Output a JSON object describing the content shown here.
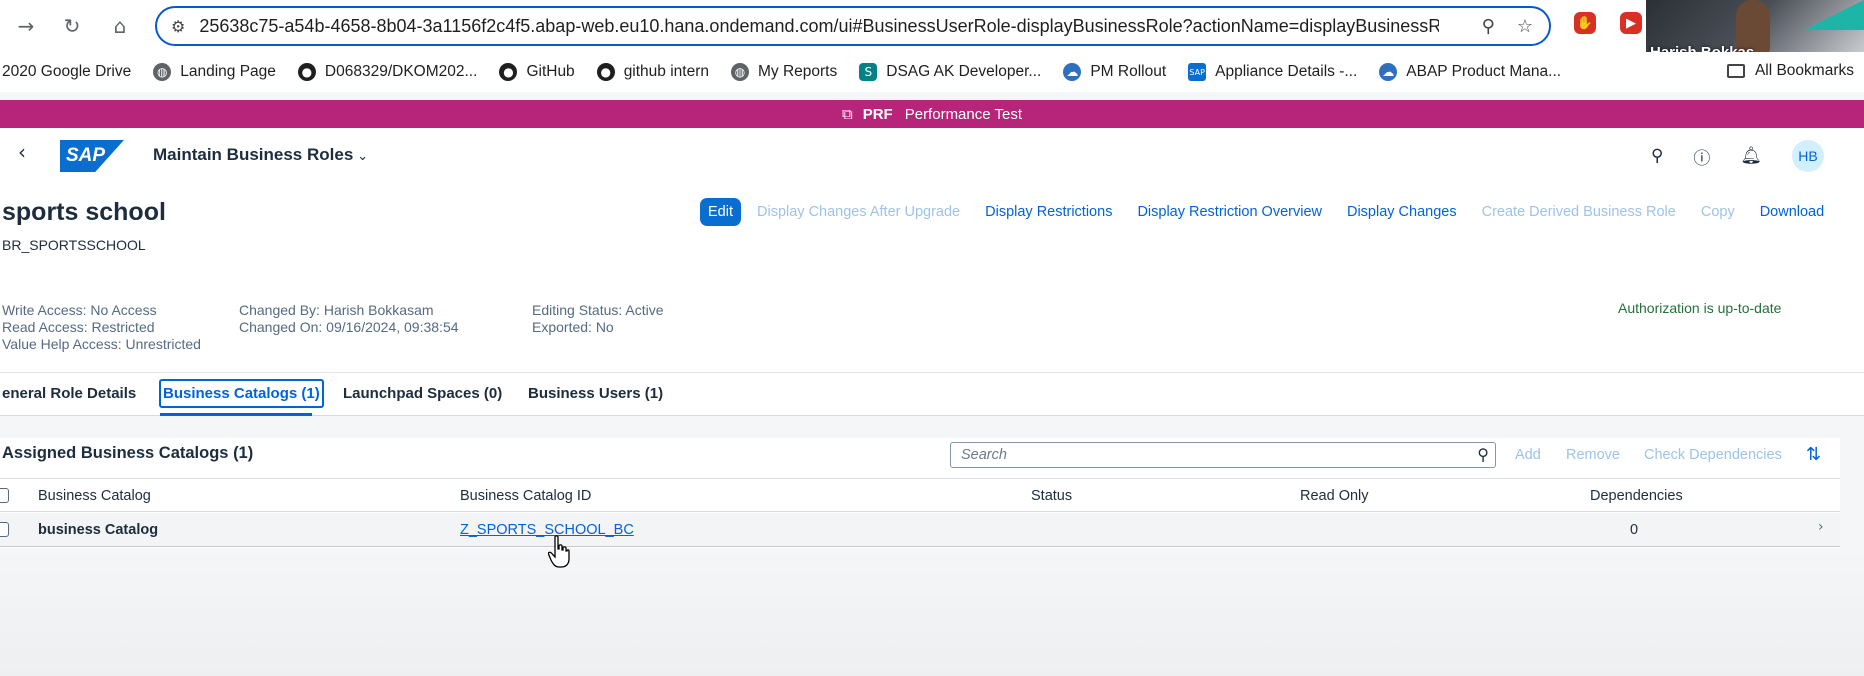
{
  "browser": {
    "url": "25638c75-a54b-4658-8b04-3a1156f2c4f5.abap-web.eu10.hana.ondemand.com/ui#BusinessUserRole-displayBusinessRole?actionName=displayBusinessR...",
    "bookmarks": [
      {
        "label": "2020 Google Drive",
        "icon": "google-drive-icon"
      },
      {
        "label": "Landing Page",
        "icon": "globe-icon",
        "color": "#5f6368"
      },
      {
        "label": "D068329/DKOM202...",
        "icon": "github-icon",
        "color": "#1f1f1f"
      },
      {
        "label": "GitHub",
        "icon": "github-icon",
        "color": "#1f1f1f"
      },
      {
        "label": "github intern",
        "icon": "github-icon",
        "color": "#1f1f1f"
      },
      {
        "label": "My Reports",
        "icon": "globe-icon",
        "color": "#5f6368"
      },
      {
        "label": "DSAG AK Developer...",
        "icon": "sharepoint-icon",
        "color": "#038387"
      },
      {
        "label": "PM Rollout",
        "icon": "cloud-icon",
        "color": "#2f6fbf"
      },
      {
        "label": "Appliance Details -...",
        "icon": "sap-icon",
        "color": "#0a6ed1"
      },
      {
        "label": "ABAP Product Mana...",
        "icon": "cloud-icon",
        "color": "#2f6fbf"
      }
    ],
    "all_bookmarks": "All Bookmarks",
    "video_name": "Harish Bokkas..."
  },
  "system_banner": {
    "id": "PRF",
    "name": "Performance Test",
    "color": "#b7257b"
  },
  "shell": {
    "app_title": "Maintain Business Roles",
    "avatar": "HB"
  },
  "header": {
    "title": "sports school",
    "subtitle": "BR_SPORTSSCHOOL",
    "actions": [
      {
        "label": "Edit",
        "state": "primary"
      },
      {
        "label": "Display Changes After Upgrade",
        "state": "disabled"
      },
      {
        "label": "Display Restrictions",
        "state": "enabled"
      },
      {
        "label": "Display Restriction Overview",
        "state": "enabled"
      },
      {
        "label": "Display Changes",
        "state": "enabled"
      },
      {
        "label": "Create Derived Business Role",
        "state": "disabled"
      },
      {
        "label": "Copy",
        "state": "disabled"
      },
      {
        "label": "Download",
        "state": "enabled"
      }
    ],
    "write_access": "Write Access: No Access",
    "read_access": "Read Access: Restricted",
    "value_help_access": "Value Help Access: Unrestricted",
    "changed_by": "Changed By: Harish Bokkasam",
    "changed_on": "Changed On: 09/16/2024, 09:38:54",
    "editing_status": "Editing Status: Active",
    "exported": "Exported: No",
    "auth_status": "Authorization is up-to-date"
  },
  "tabs": [
    {
      "label": "eneral Role Details",
      "active": false
    },
    {
      "label": "Business Catalogs (1)",
      "active": true
    },
    {
      "label": "Launchpad Spaces (0)",
      "active": false
    },
    {
      "label": "Business Users (1)",
      "active": false
    }
  ],
  "catalogs": {
    "title": "Assigned Business Catalogs (1)",
    "search_placeholder": "Search",
    "toolbar": [
      "Add",
      "Remove",
      "Check Dependencies"
    ],
    "columns": [
      "Business Catalog",
      "Business Catalog ID",
      "Status",
      "Read Only",
      "Dependencies"
    ],
    "rows": [
      {
        "name": "business Catalog",
        "id": "Z_SPORTS_SCHOOL_BC",
        "status": "",
        "read_only": "",
        "dependencies": "0"
      }
    ]
  }
}
